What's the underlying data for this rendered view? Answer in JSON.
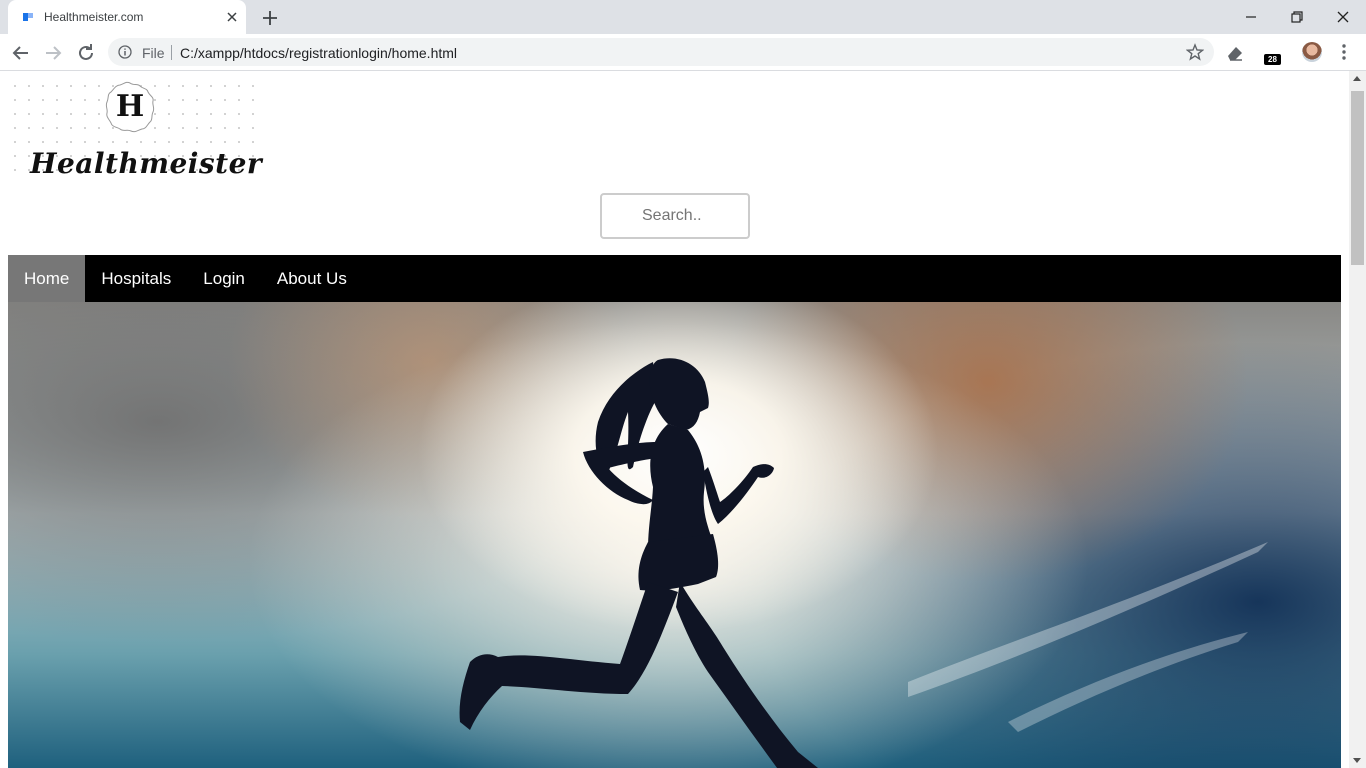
{
  "browser": {
    "tab_title": "Healthmeister.com",
    "url_scheme": "File",
    "url": "C:/xampp/htdocs/registrationlogin/home.html",
    "extension_badge": "28"
  },
  "site": {
    "logo_text": "Healthmeister",
    "logo_monogram": "H",
    "search_placeholder": "Search..",
    "nav": [
      {
        "label": "Home",
        "active": true
      },
      {
        "label": "Hospitals",
        "active": false
      },
      {
        "label": "Login",
        "active": false
      },
      {
        "label": "About Us",
        "active": false
      }
    ],
    "hero_image": "woman-running-silhouette-against-sky"
  },
  "colors": {
    "nav_background": "#000000",
    "nav_active": "#777777",
    "chrome_background": "#dee1e6"
  }
}
